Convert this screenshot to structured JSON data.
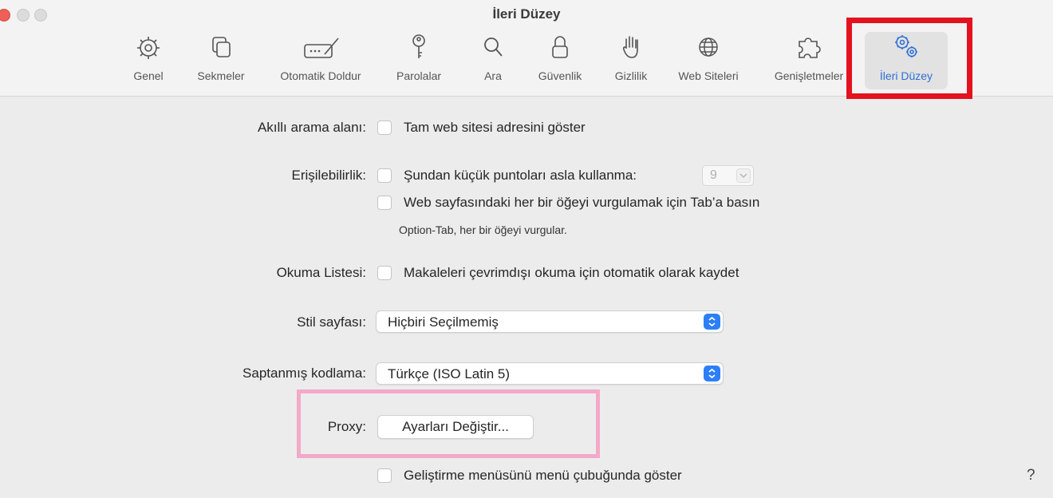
{
  "window": {
    "title": "İleri Düzey"
  },
  "toolbar": {
    "items": [
      {
        "label": "Genel",
        "icon": "gear-icon"
      },
      {
        "label": "Sekmeler",
        "icon": "tabs-icon"
      },
      {
        "label": "Otomatik Doldur",
        "icon": "autofill-pencil-icon"
      },
      {
        "label": "Parolalar",
        "icon": "key-icon"
      },
      {
        "label": "Ara",
        "icon": "magnifier-icon"
      },
      {
        "label": "Güvenlik",
        "icon": "lock-icon"
      },
      {
        "label": "Gizlilik",
        "icon": "hand-icon"
      },
      {
        "label": "Web Siteleri",
        "icon": "globe-icon"
      },
      {
        "label": "Genişletmeler",
        "icon": "puzzle-icon"
      },
      {
        "label": "İleri Düzey",
        "icon": "advanced-gears-icon",
        "selected": true
      }
    ]
  },
  "settings": {
    "smart_search": {
      "label": "Akıllı arama alanı:",
      "option": "Tam web sitesi adresini göster",
      "checked": false
    },
    "accessibility": {
      "label": "Erişilebilirlik:",
      "option1": "Şundan küçük puntoları asla kullanma:",
      "font_size": "9",
      "option2": "Web sayfasındaki her bir öğeyi vurgulamak için Tab’a basın",
      "hint": "Option-Tab, her bir öğeyi vurgular."
    },
    "reading_list": {
      "label": "Okuma Listesi:",
      "option": "Makaleleri çevrimdışı okuma için otomatik olarak kaydet"
    },
    "style_sheet": {
      "label": "Stil sayfası:",
      "value": "Hiçbiri Seçilmemiş"
    },
    "encoding": {
      "label": "Saptanmış kodlama:",
      "value": "Türkçe (ISO Latin 5)"
    },
    "proxy": {
      "label": "Proxy:",
      "button": "Ayarları Değiştir..."
    },
    "developer_menu": {
      "option": "Geliştirme menüsünü menü çubuğunda göster"
    }
  },
  "help": {
    "label": "?"
  },
  "colors": {
    "accent": "#2c7ff7",
    "highlight_red": "#e3121e",
    "highlight_pink": "#f4a9c9",
    "close_red": "#ee5f57"
  }
}
